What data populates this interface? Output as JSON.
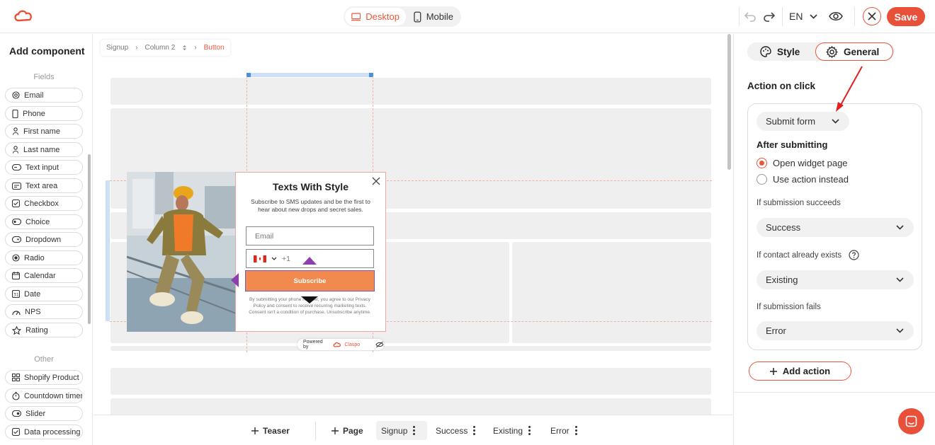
{
  "topbar": {
    "device_desktop": "Desktop",
    "device_mobile": "Mobile",
    "language": "EN",
    "save_label": "Save"
  },
  "left_panel": {
    "title": "Add component",
    "sections": [
      {
        "label": "Fields",
        "items": [
          {
            "label": "Email",
            "icon": "at-icon"
          },
          {
            "label": "Phone",
            "icon": "phone-icon"
          },
          {
            "label": "First name",
            "icon": "person-icon"
          },
          {
            "label": "Last name",
            "icon": "person-icon"
          },
          {
            "label": "Text input",
            "icon": "text-input-icon"
          },
          {
            "label": "Text area",
            "icon": "text-area-icon"
          },
          {
            "label": "Checkbox",
            "icon": "checkbox-icon"
          },
          {
            "label": "Choice",
            "icon": "choice-icon"
          },
          {
            "label": "Dropdown",
            "icon": "dropdown-icon"
          },
          {
            "label": "Radio",
            "icon": "radio-icon"
          },
          {
            "label": "Calendar",
            "icon": "calendar-icon"
          },
          {
            "label": "Date",
            "icon": "date-icon"
          },
          {
            "label": "NPS",
            "icon": "nps-icon"
          },
          {
            "label": "Rating",
            "icon": "star-icon"
          }
        ]
      },
      {
        "label": "Other",
        "items": [
          {
            "label": "Shopify Product",
            "icon": "grid-icon"
          },
          {
            "label": "Countdown timer",
            "icon": "timer-icon"
          },
          {
            "label": "Slider",
            "icon": "slider-icon"
          },
          {
            "label": "Data processing",
            "icon": "checkbox-icon"
          }
        ]
      }
    ]
  },
  "breadcrumb": {
    "items": [
      "Signup",
      "Column 2",
      "Button"
    ]
  },
  "widget": {
    "title": "Texts With Style",
    "subtitle": "Subscribe to SMS updates and be the first to hear about new drops and secret sales.",
    "email_placeholder": "Email",
    "phone_prefix": "+1",
    "subscribe_label": "Subscribe",
    "legal": "By submitting your phone number, you agree to our Privacy Policy and consent to receive recurring marketing texts. Consent isn't a condition of purchase. Unsubscribe anytime.",
    "powered_by": "Powered by",
    "brand": "Claspo"
  },
  "bottom_tabs": [
    {
      "label": "Teaser",
      "type": "add"
    },
    {
      "label": "Page",
      "type": "add"
    },
    {
      "label": "Signup",
      "type": "page",
      "active": true
    },
    {
      "label": "Success",
      "type": "page"
    },
    {
      "label": "Existing",
      "type": "page"
    },
    {
      "label": "Error",
      "type": "page"
    }
  ],
  "right_panel": {
    "tabs": {
      "style": "Style",
      "general": "General",
      "active": "General"
    },
    "heading": "Action on click",
    "action_select": "Submit form",
    "after_submitting_label": "After submitting",
    "radio_open": "Open widget page",
    "radio_action": "Use action instead",
    "selected_radio": "Open widget page",
    "succeeds_label": "If submission succeeds",
    "succeeds_value": "Success",
    "exists_label": "If contact already exists",
    "exists_value": "Existing",
    "fails_label": "If submission fails",
    "fails_value": "Error",
    "add_action_label": "Add action"
  },
  "colors": {
    "accent": "#e8503a",
    "annotation_arrow": "#e02020",
    "subscribe_button": "#f28a4f"
  }
}
